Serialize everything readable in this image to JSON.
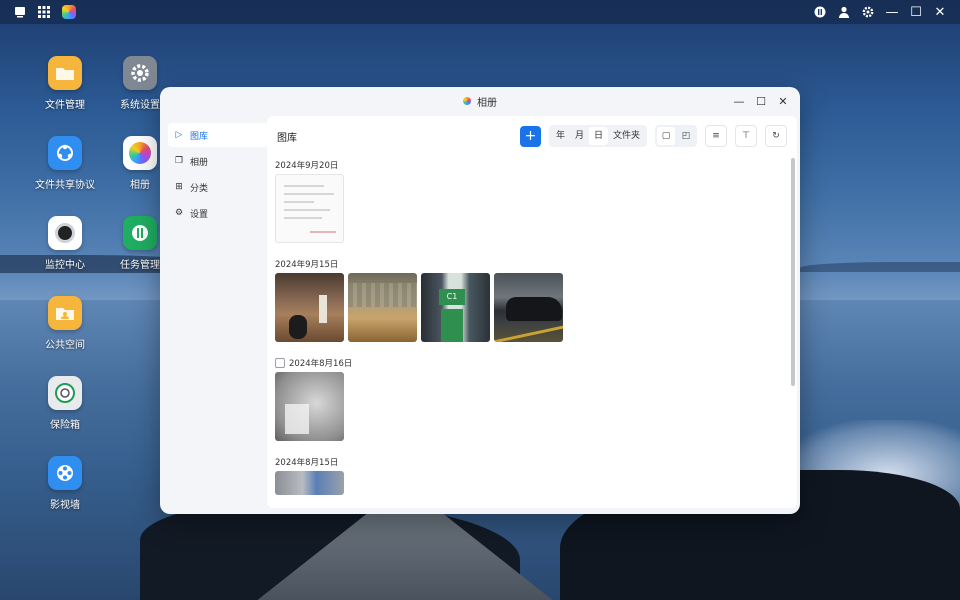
{
  "desktop": {
    "icons": [
      {
        "label": "文件管理",
        "icon": "folder-icon",
        "color": "#f6b53c"
      },
      {
        "label": "系统设置",
        "icon": "gear-icon",
        "color": "#7f8893"
      },
      {
        "label": "文件共享协议",
        "icon": "share-icon",
        "color": "#2f8ef0"
      },
      {
        "label": "相册",
        "icon": "photos-icon",
        "color": "#ffffff"
      },
      {
        "label": "监控中心",
        "icon": "camera-icon",
        "color": "#ffffff"
      },
      {
        "label": "任务管理",
        "icon": "task-icon",
        "color": "#1fae62"
      },
      {
        "label": "公共空间",
        "icon": "public-folder-icon",
        "color": "#f6b53c"
      },
      {
        "label": "保险箱",
        "icon": "safe-icon",
        "color": "#e8eaec"
      },
      {
        "label": "影视墙",
        "icon": "film-icon",
        "color": "#2f8ef0"
      }
    ]
  },
  "window": {
    "title": "相册",
    "sidebar": [
      {
        "label": "图库",
        "active": true,
        "icon": "gallery-icon"
      },
      {
        "label": "相册",
        "active": false,
        "icon": "album-icon"
      },
      {
        "label": "分类",
        "active": false,
        "icon": "category-icon"
      },
      {
        "label": "设置",
        "active": false,
        "icon": "settings-icon"
      }
    ],
    "main_title": "图库",
    "add_label": "+",
    "view_modes": [
      "年",
      "月",
      "日",
      "文件夹"
    ],
    "active_view": "日",
    "groups": [
      {
        "date": "2024年9月20日",
        "checkbox": false,
        "photos": [
          "document"
        ]
      },
      {
        "date": "2024年9月15日",
        "checkbox": false,
        "photos": [
          "hall",
          "room",
          "parking",
          "car"
        ]
      },
      {
        "date": "2024年8月16日",
        "checkbox": true,
        "photos": [
          "gray"
        ]
      },
      {
        "date": "2024年8月15日",
        "checkbox": false,
        "photos": [
          "strip"
        ]
      }
    ],
    "parking_sign": "C1"
  },
  "accent": "#1a73e8"
}
